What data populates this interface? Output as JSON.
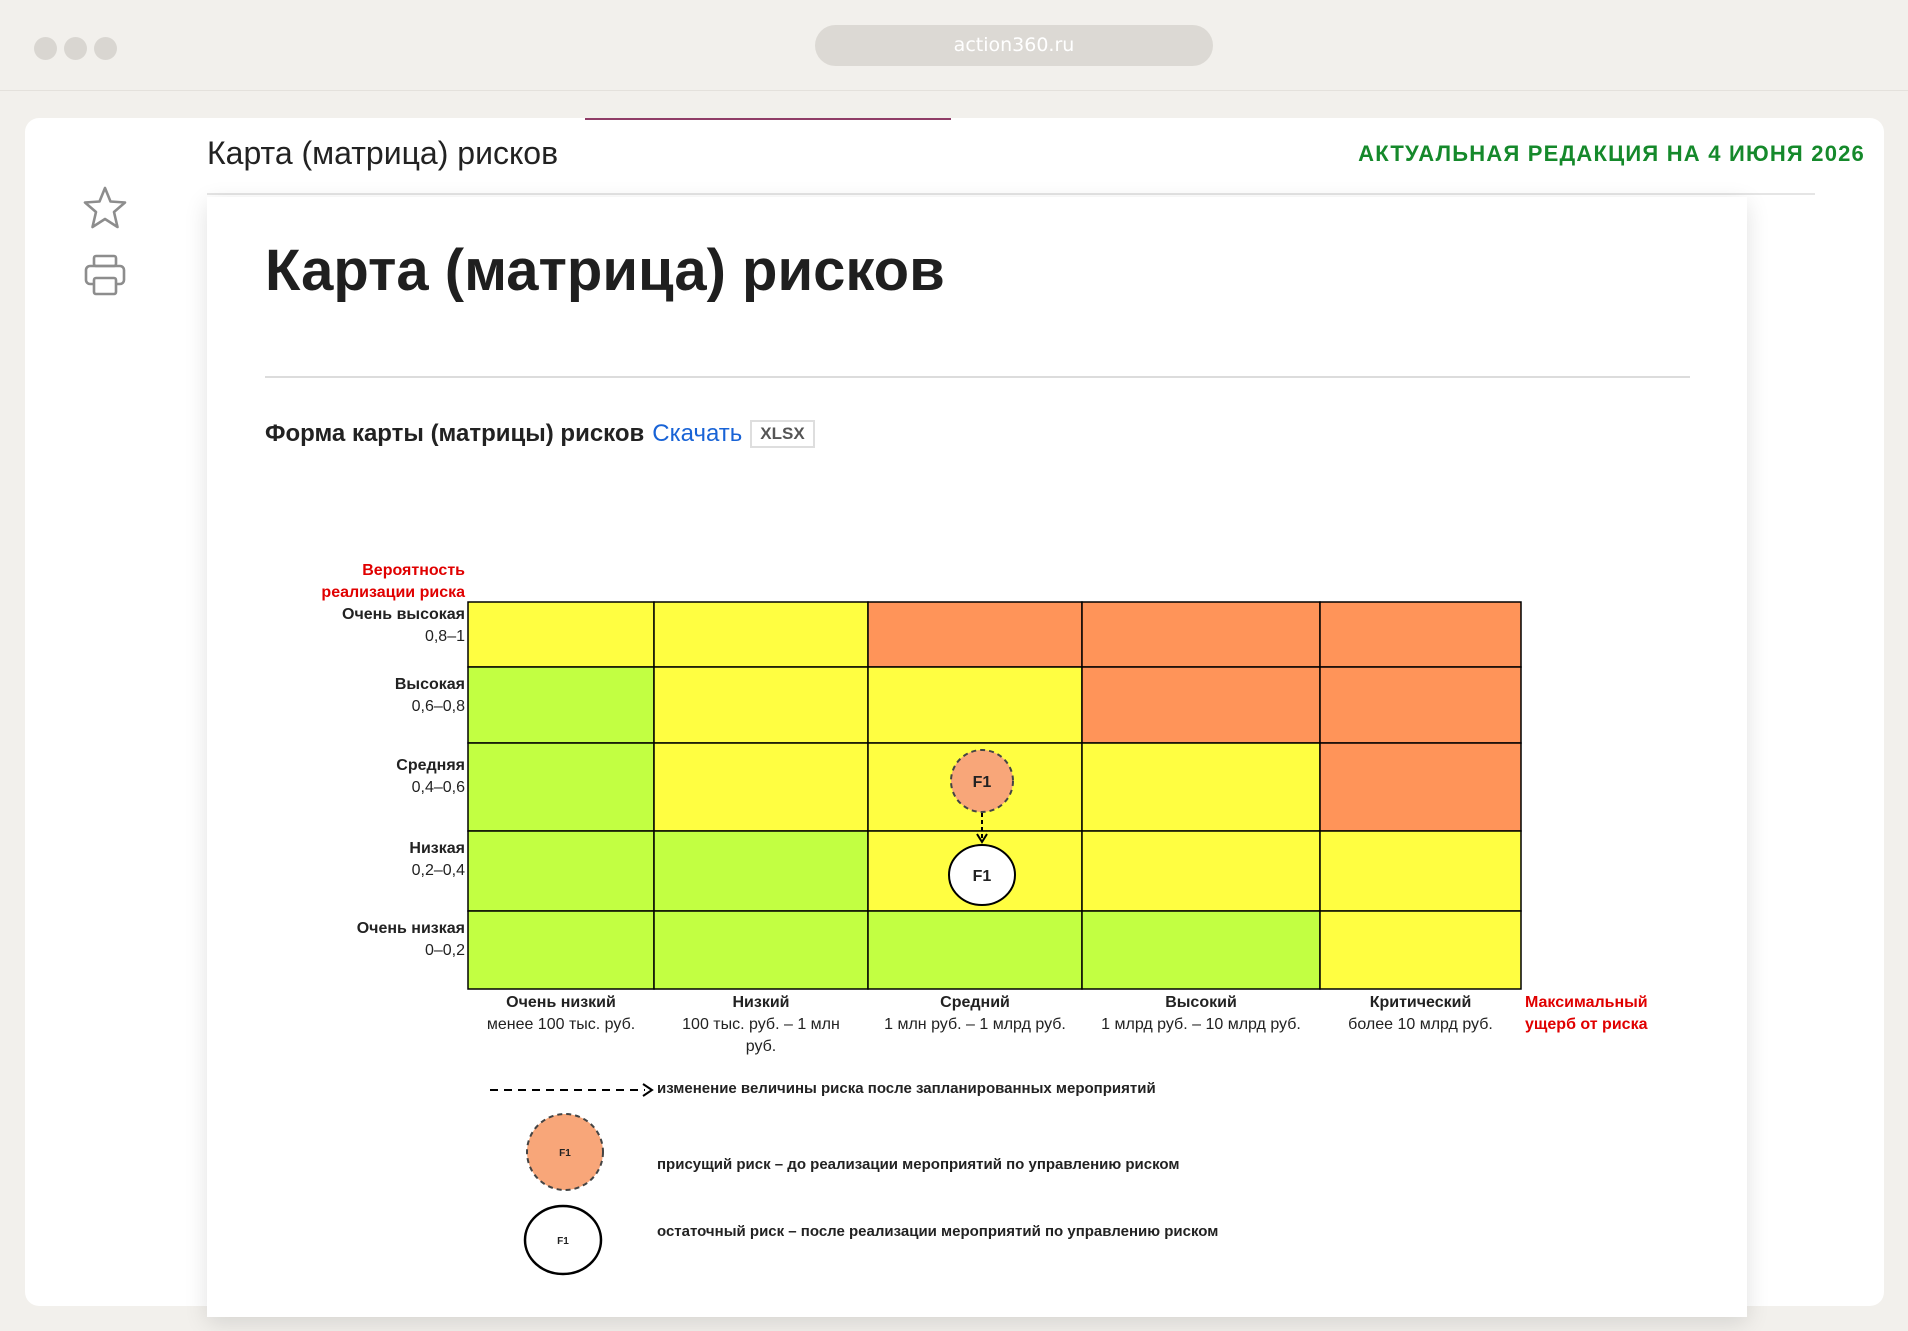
{
  "browser": {
    "url": "action360.ru"
  },
  "header": {
    "title": "Карта (матрица) рисков",
    "edition": "АКТУАЛЬНАЯ РЕДАКЦИЯ НА 4 ИЮНЯ 2026"
  },
  "sidebar": {
    "icons": [
      "star-icon",
      "print-icon"
    ]
  },
  "main": {
    "title": "Карта (матрица) рисков",
    "form_label": "Форма карты (матрицы) рисков",
    "download_label": "Скачать",
    "format_badge": "XLSX"
  },
  "matrix": {
    "y_title_1": "Вероятность",
    "y_title_2": "реализации риска",
    "x_title_1": "Максимальный",
    "x_title_2": "ущерб от риска",
    "rows": [
      {
        "name": "Очень высокая",
        "range": "0,8–1"
      },
      {
        "name": "Высокая",
        "range": "0,6–0,8"
      },
      {
        "name": "Средняя",
        "range": "0,4–0,6"
      },
      {
        "name": "Низкая",
        "range": "0,2–0,4"
      },
      {
        "name": "Очень низкая",
        "range": "0–0,2"
      }
    ],
    "cols": [
      {
        "name": "Очень низкий",
        "range_1": "менее 100 тыс. руб.",
        "range_2": ""
      },
      {
        "name": "Низкий",
        "range_1": "100 тыс. руб. – 1 млн",
        "range_2": "руб."
      },
      {
        "name": "Средний",
        "range_1": "1 млн руб. – 1 млрд руб.",
        "range_2": ""
      },
      {
        "name": "Высокий",
        "range_1": "1 млрд руб. – 10 млрд руб.",
        "range_2": ""
      },
      {
        "name": "Критический",
        "range_1": "более 10 млрд руб.",
        "range_2": ""
      }
    ],
    "levels": [
      [
        "yellow",
        "yellow",
        "orange",
        "orange",
        "orange"
      ],
      [
        "green",
        "yellow",
        "yellow",
        "orange",
        "orange"
      ],
      [
        "green",
        "yellow",
        "yellow",
        "yellow",
        "orange"
      ],
      [
        "green",
        "green",
        "yellow",
        "yellow",
        "yellow"
      ],
      [
        "green",
        "green",
        "green",
        "green",
        "yellow"
      ]
    ],
    "colors": {
      "green": "#c2ff42",
      "yellow": "#fffe41",
      "orange": "#ff9459",
      "circle_inherent": "#f8a679",
      "label_red": "#e00000"
    },
    "inherent_risk": {
      "label": "F1",
      "row": 2,
      "col": 2
    },
    "residual_risk": {
      "label": "F1",
      "row": 3,
      "col": 2
    }
  },
  "legend": {
    "arrow_text": "изменение величины риска после запланированных мероприятий",
    "inherent_text": "присущий риск – до реализации мероприятий по управлению риском",
    "residual_text": "остаточный риск – после реализации мероприятий по управлению риском",
    "inherent_label": "F1",
    "residual_label": "F1"
  }
}
